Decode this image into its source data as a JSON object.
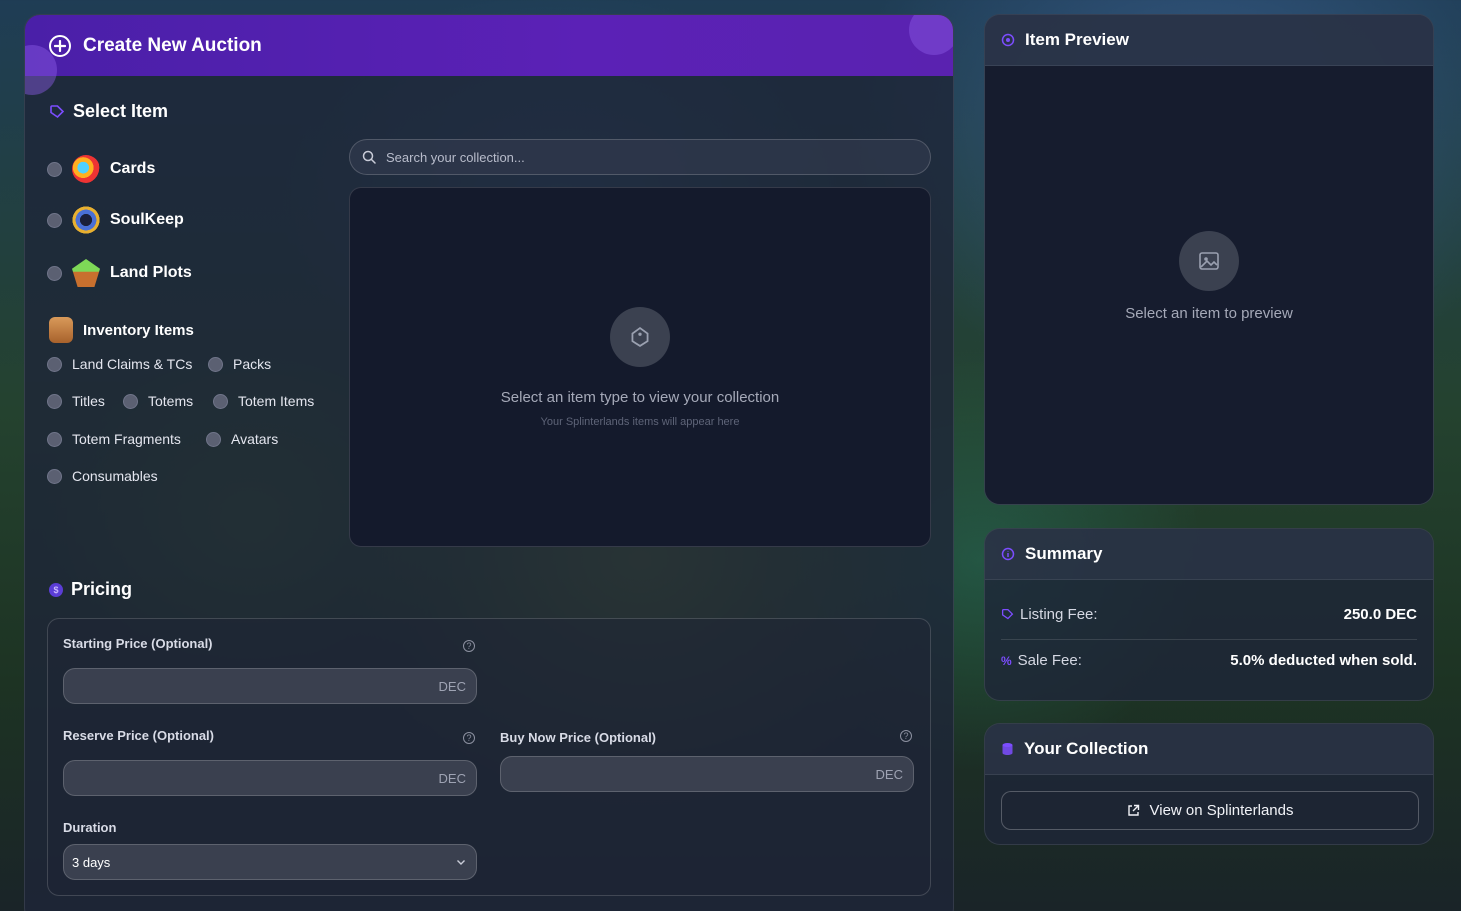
{
  "header": {
    "title": "Create New Auction"
  },
  "select_item": {
    "title": "Select Item",
    "types": [
      {
        "label": "Cards",
        "icon": "cards-icon"
      },
      {
        "label": "SoulKeep",
        "icon": "soulkeep-icon"
      },
      {
        "label": "Land Plots",
        "icon": "land-plots-icon"
      }
    ],
    "inventory": {
      "title": "Inventory Items",
      "options": [
        "Land Claims & TCs",
        "Packs",
        "Titles",
        "Totems",
        "Totem Items",
        "Totem Fragments",
        "Avatars",
        "Consumables"
      ]
    },
    "search_placeholder": "Search your collection...",
    "empty_title": "Select an item type to view your collection",
    "empty_subtitle": "Your Splinterlands items will appear here"
  },
  "pricing": {
    "title": "Pricing",
    "starting_label": "Starting Price (Optional)",
    "reserve_label": "Reserve Price (Optional)",
    "buy_now_label": "Buy Now Price (Optional)",
    "currency": "DEC",
    "duration_label": "Duration",
    "duration_value": "3 days"
  },
  "preview": {
    "title": "Item Preview",
    "empty_text": "Select an item to preview"
  },
  "summary": {
    "title": "Summary",
    "listing_fee_label": "Listing Fee:",
    "listing_fee_value": "250.0 DEC",
    "sale_fee_label": "Sale Fee:",
    "sale_fee_value": "5.0% deducted when sold."
  },
  "collection": {
    "title": "Your Collection",
    "button_label": "View on Splinterlands"
  },
  "colors": {
    "accent": "#5b21b6",
    "panel": "#1e2638"
  }
}
